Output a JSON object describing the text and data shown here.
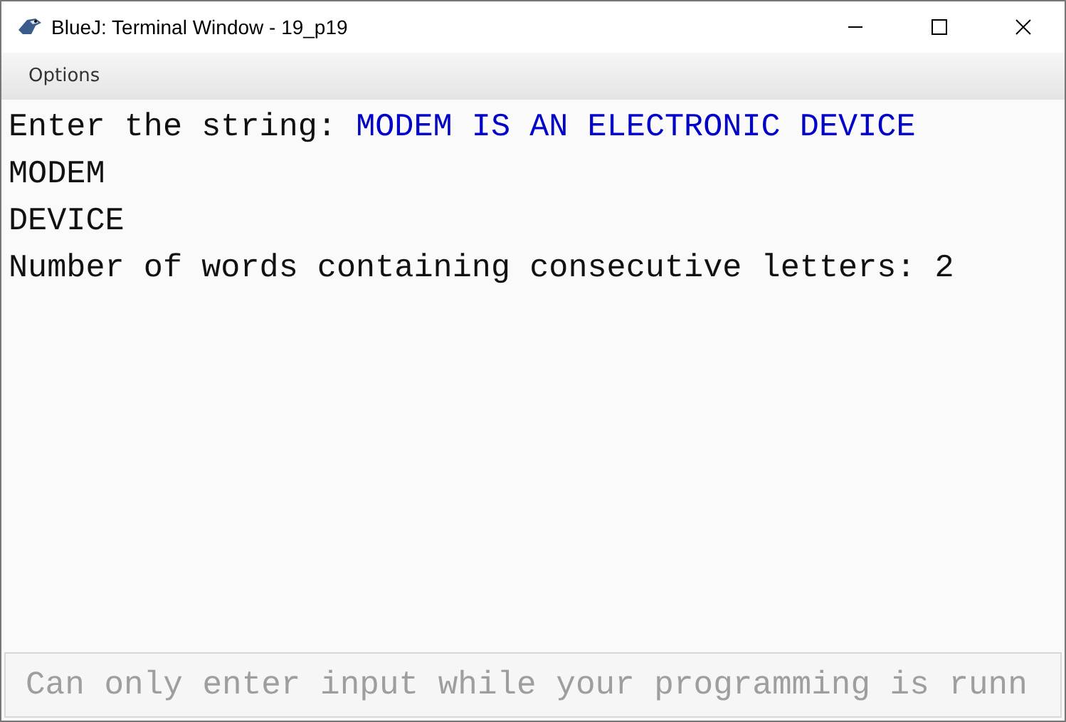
{
  "window": {
    "title": "BlueJ: Terminal Window - 19_p19"
  },
  "menu": [
    "Options"
  ],
  "terminal": {
    "lines": [
      {
        "segments": [
          {
            "kind": "output",
            "text": "Enter the string: "
          },
          {
            "kind": "input",
            "text": "MODEM IS AN ELECTRONIC DEVICE"
          }
        ]
      },
      {
        "segments": [
          {
            "kind": "output",
            "text": "MODEM"
          }
        ]
      },
      {
        "segments": [
          {
            "kind": "output",
            "text": "DEVICE"
          }
        ]
      },
      {
        "segments": [
          {
            "kind": "output",
            "text": "Number of words containing consecutive letters: 2"
          }
        ]
      }
    ]
  },
  "input": {
    "placeholder": "Can only enter input while your programming is runn",
    "disabled": true
  }
}
